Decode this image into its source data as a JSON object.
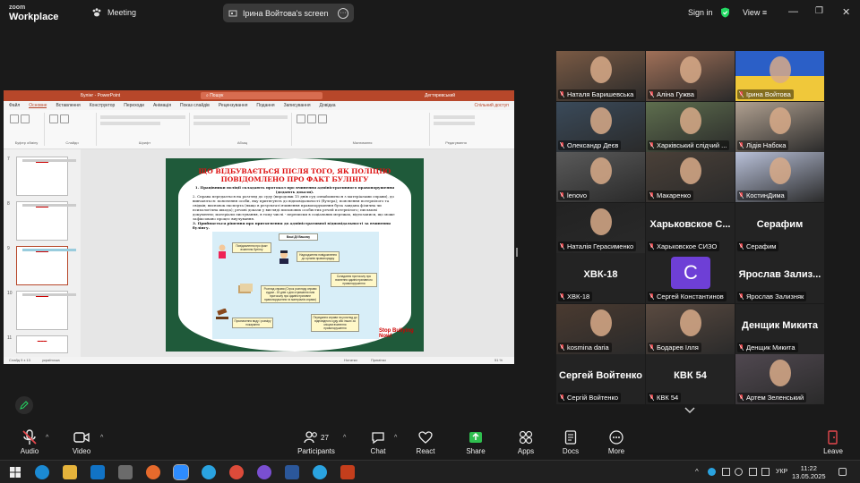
{
  "app": {
    "brand_top": "zoom",
    "brand_bottom": "Workplace",
    "meeting_label": "Meeting",
    "screen_owner": "Ірина Войтова's screen",
    "signin": "Sign in",
    "view": "View"
  },
  "powerpoint": {
    "title": "Булінг  -  PowerPoint",
    "search": "Пошук",
    "user": "Дегтяревський",
    "tabs": [
      "Файл",
      "Основне",
      "Вставлення",
      "Конструктор",
      "Переходи",
      "Анімація",
      "Показ слайдів",
      "Рецензування",
      "Подання",
      "Записування",
      "Довідка"
    ],
    "share_btn": "Спільний доступ",
    "groups": [
      "Буфер обміну",
      "Слайди",
      "Шрифт",
      "Абзац",
      "Малювання",
      "Редагування"
    ],
    "slide_numbers": [
      "7",
      "8",
      "9",
      "10",
      "11"
    ],
    "status_left": "Слайд 9 з 13",
    "status_lang": "українська",
    "status_notes": "Нотатки",
    "status_comments": "Примітки",
    "zoom": "51 %",
    "slide": {
      "title": "ЩО ВІДБУВАЄТЬСЯ ПІСЛЯ ТОГО, ЯК ПОЛІЦІЮ ПОВІДОМЛЕНО ПРО ФАКТ БУЛІНГУ",
      "p1": "1. Працівники поліції складають протокол про вчинення адміністративного правопорушення (додають докази).",
      "p2": "2. Справа передається на розгляд до суду (впродовж 15 днів суд ознайомиться з матеріалами справи), до вивчаються: пояснення особи, яку притягують до відповідальності (булера); пояснення потерпілого та свідків; висновок експерта (якщо в результаті вчинення правопорушення була завдана фізична чи психологічна шкода); речові докази у вигляді письмових особистих речей потерпілого; письмові документи; матеріали листування, в тому числі - переписки в соціальних мережах, відеозаписи, що може зафіксовано процес виучування.",
      "p3": "3. Приймається рішення про притягнення до адміністративної відповідальності за вчинення булінгу.",
      "diagram_title": "Ваші Дії Вашому",
      "d1": "Повідомлення про факт вчинення булінгу",
      "d2": "Надходження повідомлення до органів правопорядку",
      "d3": "Складання протоколу про вчинення адміністративного правопорушення",
      "d4": "Розгляд справи (Строк розгляду справи судом - 15 днів з дня отримання ним протоколу про адміністративне правопорушення та матеріалів справи)",
      "d5": "Призначення виду і розміру покарання",
      "d6": "Передання справи на розгляд до відповідного суду або інших за місцем вчинення правопорушення",
      "stamp": "Stop Bullying Now!"
    }
  },
  "participants": [
    {
      "name": "Наталя Баришевська",
      "type": "video"
    },
    {
      "name": "Аліна Гужва",
      "type": "video"
    },
    {
      "name": "Ірина Войтова",
      "type": "video"
    },
    {
      "name": "Олександр Деєв",
      "type": "video"
    },
    {
      "name": "Харківський слідчий ...",
      "type": "video"
    },
    {
      "name": "Лідія Набока",
      "type": "video"
    },
    {
      "name": "lenovo",
      "type": "video"
    },
    {
      "name": "Макаренко",
      "type": "video"
    },
    {
      "name": "КостинДима",
      "type": "video"
    },
    {
      "name": "Наталія Герасименко",
      "type": "video"
    },
    {
      "name": "Харьковское СИЗО",
      "type": "name",
      "big": "Харьковское С..."
    },
    {
      "name": "Серафим",
      "type": "name",
      "big": "Серафим"
    },
    {
      "name": "ХВК-18",
      "type": "name",
      "big": "ХВК-18"
    },
    {
      "name": "Сергей Константинов",
      "type": "avatar",
      "initial": "C"
    },
    {
      "name": "Ярослав Зализняк",
      "type": "name",
      "big": "Ярослав  Зализ..."
    },
    {
      "name": "kosmina daria",
      "type": "video"
    },
    {
      "name": "Бодарев Ілля",
      "type": "video"
    },
    {
      "name": "Денщик Микита",
      "type": "name",
      "big": "Денщик Микита"
    },
    {
      "name": "Сергій Войтенко",
      "type": "name",
      "big": "Сергей Войтенко"
    },
    {
      "name": "КВК 54",
      "type": "name",
      "big": "КВК 54"
    },
    {
      "name": "Артем Зеленський",
      "type": "video"
    }
  ],
  "toolbar": {
    "audio": "Audio",
    "video": "Video",
    "participants": "Participants",
    "participants_count": "27",
    "chat": "Chat",
    "react": "React",
    "share": "Share",
    "apps": "Apps",
    "docs": "Docs",
    "more": "More",
    "leave": "Leave"
  },
  "taskbar": {
    "lang": "УКР",
    "time": "11:22",
    "date": "13.05.2025"
  },
  "colors": {
    "accent_green": "#23d963",
    "share_green": "#2fbf4f",
    "leave_red": "#e5484d",
    "ppt_red": "#b7472a"
  }
}
